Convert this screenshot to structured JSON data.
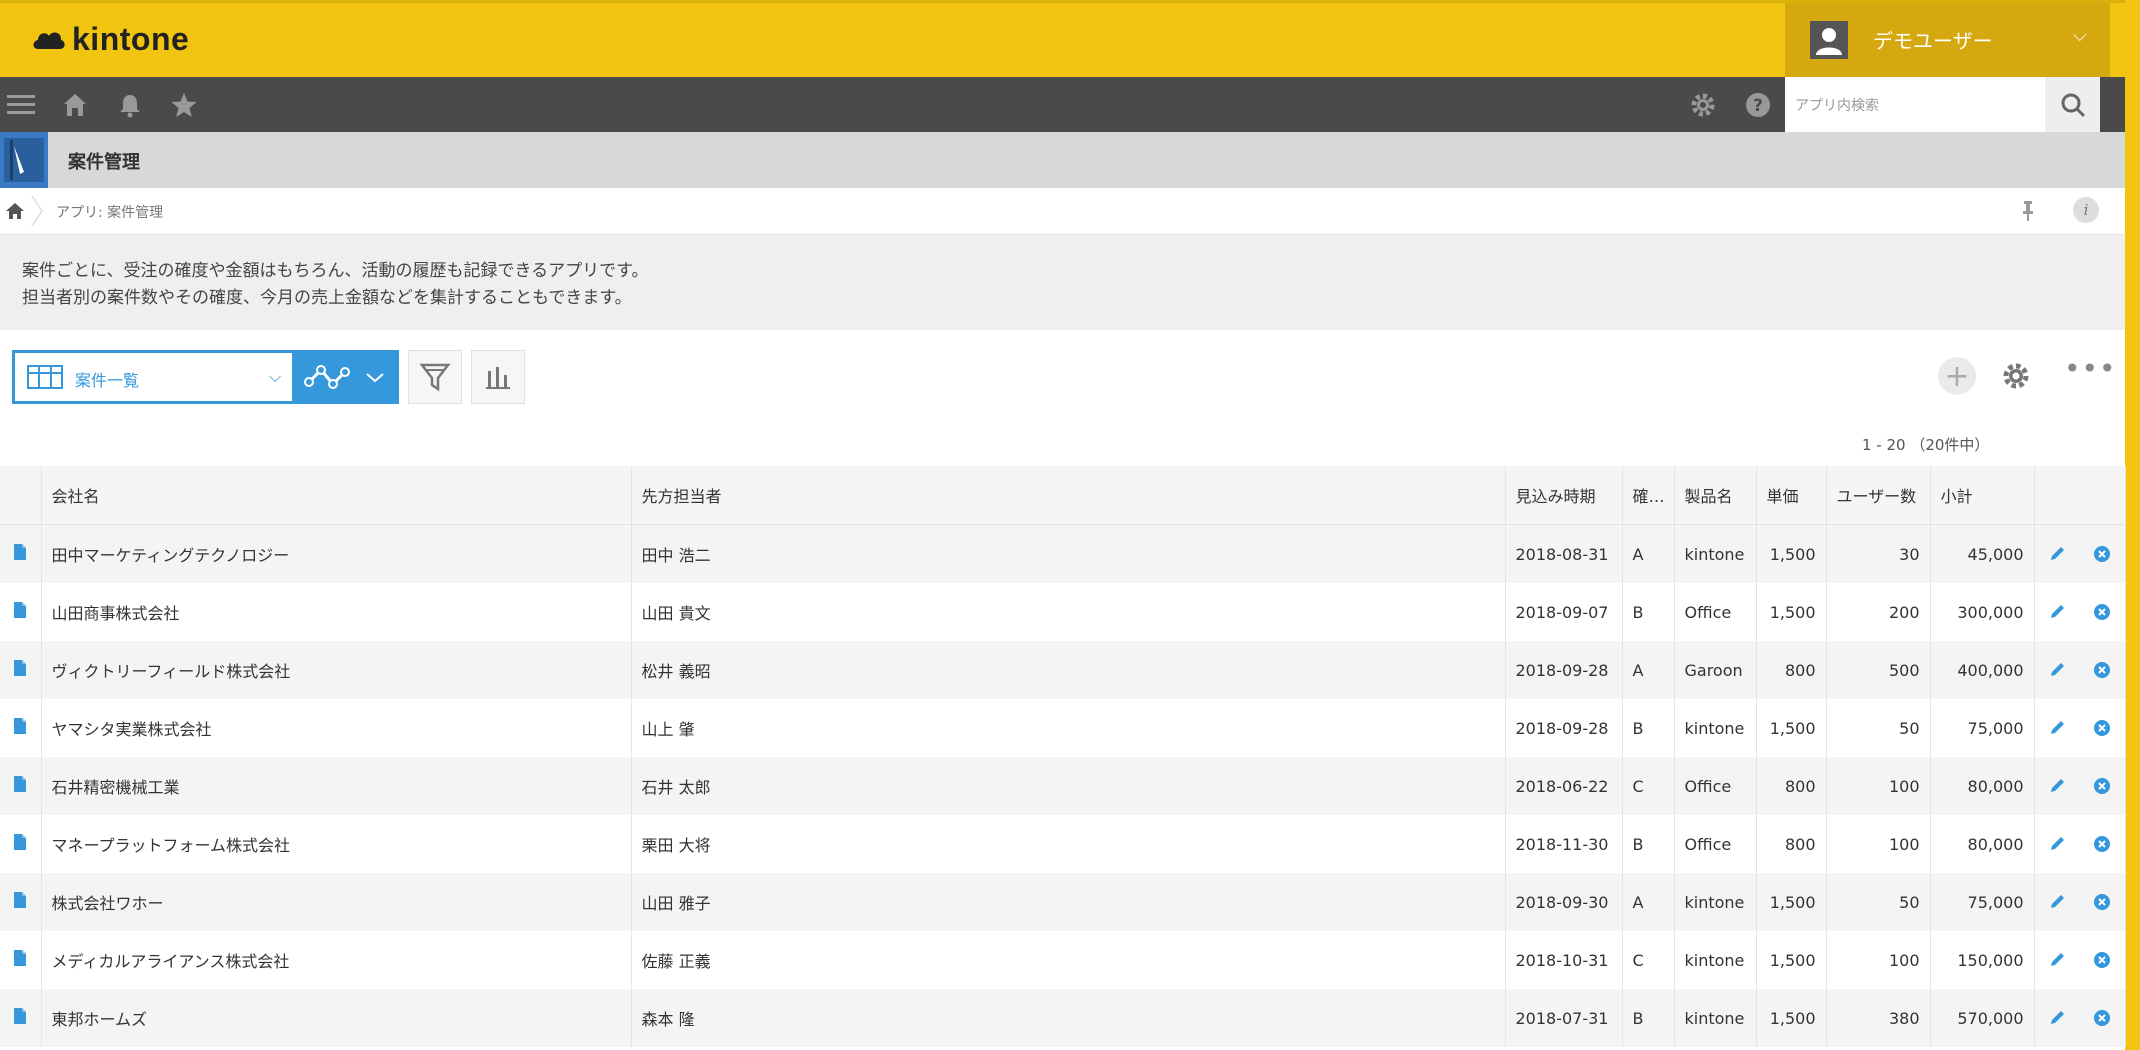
{
  "header": {
    "brand": "kintone",
    "user_name": "デモユーザー"
  },
  "toolbar": {
    "search_placeholder": "アプリ内検索"
  },
  "app": {
    "title": "案件管理"
  },
  "breadcrumb": {
    "text": "アプリ: 案件管理",
    "info_label": "i"
  },
  "description": {
    "line1": "案件ごとに、受注の確度や金額はもちろん、活動の履歴も記録できるアプリです。",
    "line2": "担当者別の案件数やその確度、今月の売上金額などを集計することもできます。"
  },
  "view": {
    "selected": "案件一覧",
    "record_count": "1 - 20 （20件中）"
  },
  "table": {
    "headers": [
      "会社名",
      "先方担当者",
      "見込み時期",
      "確度",
      "製品名",
      "単価",
      "ユーザー数",
      "小計"
    ],
    "rows": [
      [
        "田中マーケティングテクノロジー",
        "田中 浩二",
        "2018-08-31",
        "A",
        "kintone",
        "1,500",
        "30",
        "45,000"
      ],
      [
        "山田商事株式会社",
        "山田 貴文",
        "2018-09-07",
        "B",
        "Office",
        "1,500",
        "200",
        "300,000"
      ],
      [
        "ヴィクトリーフィールド株式会社",
        "松井 義昭",
        "2018-09-28",
        "A",
        "Garoon",
        "800",
        "500",
        "400,000"
      ],
      [
        "ヤマシタ実業株式会社",
        "山上 肇",
        "2018-09-28",
        "B",
        "kintone",
        "1,500",
        "50",
        "75,000"
      ],
      [
        "石井精密機械工業",
        "石井 太郎",
        "2018-06-22",
        "C",
        "Office",
        "800",
        "100",
        "80,000"
      ],
      [
        "マネープラットフォーム株式会社",
        "栗田 大将",
        "2018-11-30",
        "B",
        "Office",
        "800",
        "100",
        "80,000"
      ],
      [
        "株式会社ワホー",
        "山田 雅子",
        "2018-09-30",
        "A",
        "kintone",
        "1,500",
        "50",
        "75,000"
      ],
      [
        "メディカルアライアンス株式会社",
        "佐藤 正義",
        "2018-10-31",
        "C",
        "kintone",
        "1,500",
        "100",
        "150,000"
      ],
      [
        "東邦ホームズ",
        "森本 隆",
        "2018-07-31",
        "B",
        "kintone",
        "1,500",
        "380",
        "570,000"
      ]
    ]
  },
  "icons": {
    "menu": "menu-icon",
    "home": "home-icon",
    "bell": "bell-icon",
    "star": "star-icon",
    "gear": "gear-icon",
    "help": "help-icon",
    "search": "search-icon"
  },
  "colors": {
    "header_bg": "#f1c40f",
    "toolbar_bg": "#4a4a4a",
    "accent": "#3498db"
  }
}
